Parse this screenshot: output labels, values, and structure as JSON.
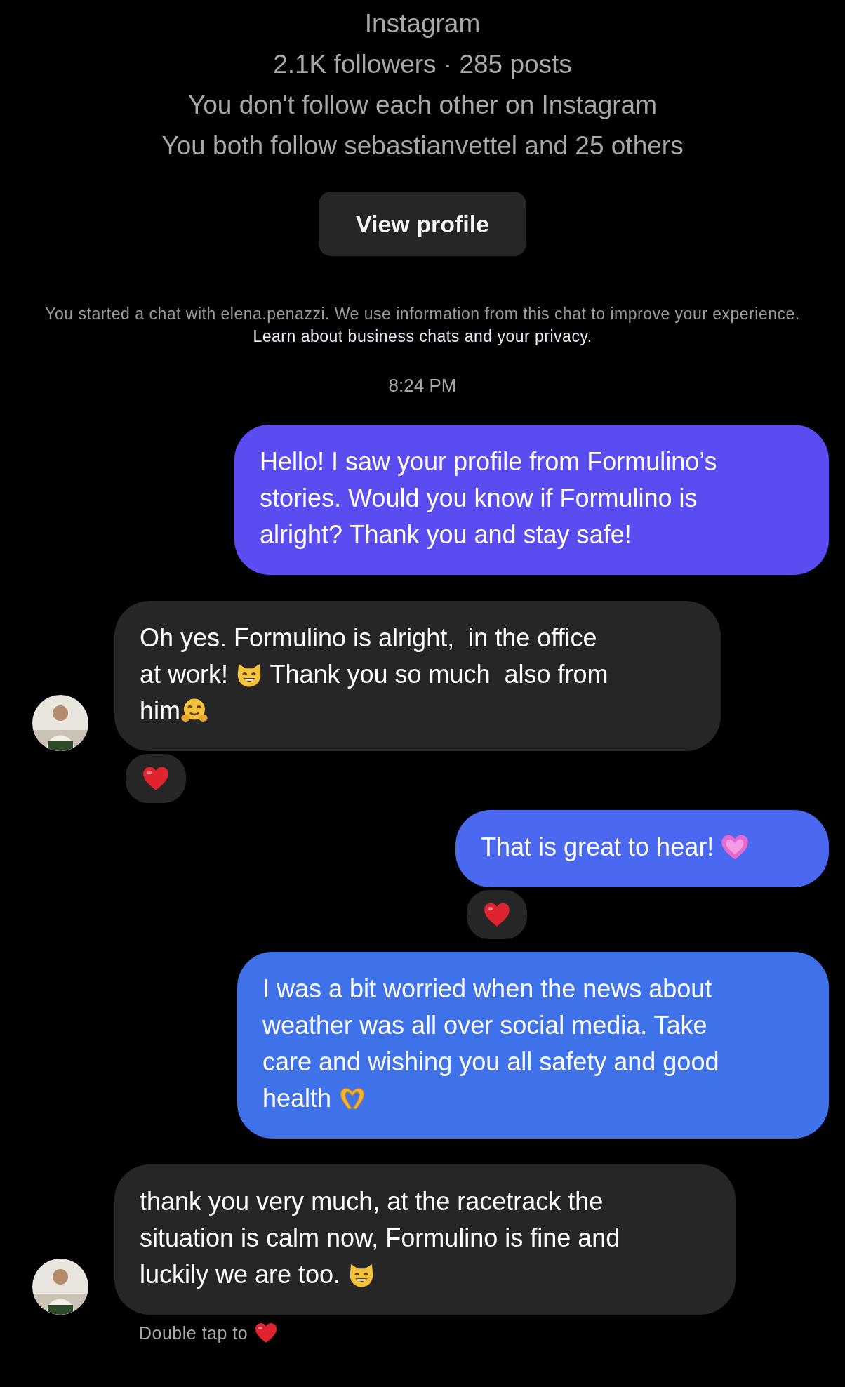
{
  "profile": {
    "platform": "Instagram",
    "stats": "2.1K followers · 285 posts",
    "follow_status": "You don't follow each other on Instagram",
    "mutual": "You both follow sebastianvettel and 25 others",
    "button": "View profile"
  },
  "notice": {
    "text": "You started a chat with elena.penazzi. We use information from this chat to improve your experience.",
    "link": "Learn about business chats and your privacy."
  },
  "timestamp": "8:24 PM",
  "messages": [
    {
      "kind": "sent",
      "reacted": false,
      "lines": [
        [
          {
            "kind": "text",
            "text": "Hello! I saw your profile from Formulino’s"
          }
        ],
        [
          {
            "kind": "text",
            "text": "stories. Would you know if Formulino is"
          }
        ],
        [
          {
            "kind": "text",
            "text": "alright? Thank you and stay safe!"
          }
        ]
      ]
    },
    {
      "kind": "received",
      "reacted": true,
      "lines": [
        [
          {
            "kind": "text",
            "text": "Oh yes. Formulino is alright,  in the office"
          }
        ],
        [
          {
            "kind": "text",
            "text": "at work! "
          },
          {
            "kind": "cat-face"
          },
          {
            "kind": "text",
            "text": " Thank you so much  also from"
          }
        ],
        [
          {
            "kind": "text",
            "text": "him"
          },
          {
            "kind": "hugging-face"
          }
        ]
      ]
    },
    {
      "kind": "sent",
      "reacted": true,
      "lines": [
        [
          {
            "kind": "text",
            "text": "That is great to hear! "
          },
          {
            "kind": "sparkling-heart"
          }
        ]
      ]
    },
    {
      "kind": "sent",
      "reacted": false,
      "lines": [
        [
          {
            "kind": "text",
            "text": "I was a bit worried when the news about"
          }
        ],
        [
          {
            "kind": "text",
            "text": "weather was all over social media. Take"
          }
        ],
        [
          {
            "kind": "text",
            "text": "care and wishing you all safety and good"
          }
        ],
        [
          {
            "kind": "text",
            "text": "health "
          },
          {
            "kind": "heart-hands"
          }
        ]
      ]
    },
    {
      "kind": "received",
      "reacted": false,
      "lines": [
        [
          {
            "kind": "text",
            "text": "thank you very much, at the racetrack the"
          }
        ],
        [
          {
            "kind": "text",
            "text": "situation is calm now, Formulino is fine and"
          }
        ],
        [
          {
            "kind": "text",
            "text": "luckily we are too. "
          },
          {
            "kind": "cat-face"
          }
        ]
      ]
    }
  ],
  "hint": {
    "text": "Double tap to"
  }
}
